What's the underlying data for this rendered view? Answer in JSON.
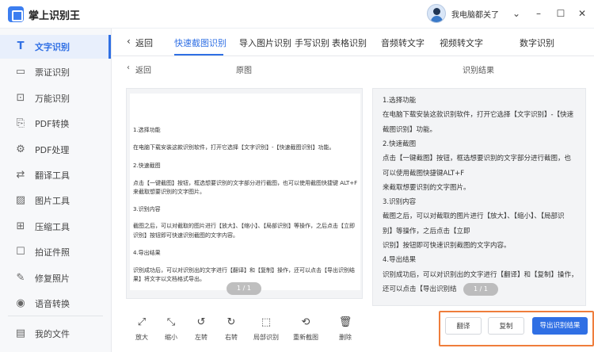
{
  "app": {
    "title": "掌上识别王",
    "user_name": "我电脑都关了"
  },
  "window_controls": {
    "chevron": "⌄",
    "minimize": "–",
    "maximize": "☐",
    "close": "✕"
  },
  "sidebar": {
    "items": [
      {
        "label": "文字识别",
        "icon": "text-recognition-icon",
        "active": true
      },
      {
        "label": "票证识别",
        "icon": "ticket-icon"
      },
      {
        "label": "万能识别",
        "icon": "scan-icon"
      },
      {
        "label": "PDF转换",
        "icon": "pdf-icon"
      },
      {
        "label": "PDF处理",
        "icon": "pdf-process-icon"
      },
      {
        "label": "翻译工具",
        "icon": "translate-icon"
      },
      {
        "label": "图片工具",
        "icon": "image-icon"
      },
      {
        "label": "压缩工具",
        "icon": "compress-icon"
      },
      {
        "label": "拍证件照",
        "icon": "id-photo-icon"
      },
      {
        "label": "修复照片",
        "icon": "repair-icon"
      },
      {
        "label": "语音转换",
        "icon": "voice-icon"
      }
    ],
    "files_label": "我的文件"
  },
  "tabs": {
    "back_label": "返回",
    "items": [
      "快速截图识别",
      "导入图片识别",
      "手写识别",
      "表格识别",
      "音频转文字",
      "视频转文字",
      "数字识别"
    ],
    "active_index": 0
  },
  "subheader": {
    "back_label": "返回",
    "original_label": "原图",
    "result_label": "识别结果"
  },
  "original_doc": {
    "lines": [
      "1.选择功能",
      "在电脑下载安装这款识别软件，打开它选择【文字识别】-【快速截图识别】功能。",
      "2.快速截图",
      "点击【一键截图】按钮，框选想要识别的文字部分进行截图，也可以使用截图快捷键 ALT+F",
      "来截取想要识别的文字图片。",
      "3.识别内容",
      "截图之后，可以对截取的图片进行【放大】、【缩小】、【局部识别】等操作，之后点击【立即",
      "识别】按钮即可快速识别截图的文字内容。",
      "4.导出结果",
      "识别成功后，可以对识别出的文字进行【翻译】和【复制】操作，还可以点击【导出识别结",
      "果】将文字以文档格式导出。"
    ],
    "page_indicator": "1 / 1"
  },
  "result_doc": {
    "lines": [
      "1.选择功能",
      "在电脑下载安装这款识别软件，打开它选择【文字识别】-【快速",
      "截图识别】功能。",
      "2.快速截图",
      "点击【一键截图】按钮，框选想要识别的文字部分进行截图，也",
      "可以使用截图快捷键ALT+F",
      "来截取想要识别的文字图片。",
      "3.识别内容",
      "截图之后，可以对截取的图片进行【放大】、【缩小】、【局部识",
      "别】等操作，之后点击【立即",
      "识别】按钮即可快速识别截图的文字内容。",
      "4.导出结果",
      "识别成功后，可以对识别出的文字进行【翻译】和【复制】操作，",
      "还可以点击【导出识别结"
    ],
    "page_indicator": "1 / 1"
  },
  "toolbar": {
    "tools": [
      {
        "label": "放大",
        "icon": "zoom-in-icon",
        "glyph": "⤢"
      },
      {
        "label": "缩小",
        "icon": "zoom-out-icon",
        "glyph": "⤡"
      },
      {
        "label": "左转",
        "icon": "rotate-left-icon",
        "glyph": "↺"
      },
      {
        "label": "右转",
        "icon": "rotate-right-icon",
        "glyph": "↻"
      },
      {
        "label": "局部识别",
        "icon": "partial-recognize-icon",
        "glyph": "⬚"
      },
      {
        "label": "重新截图",
        "icon": "recapture-icon",
        "glyph": "⟲"
      },
      {
        "label": "删除",
        "icon": "delete-icon",
        "glyph": "🗑"
      }
    ]
  },
  "actions": {
    "translate_label": "翻译",
    "copy_label": "复制",
    "export_label": "导出识别结果"
  },
  "colors": {
    "accent": "#2f6fe4",
    "highlight_border": "#ef7d3c",
    "sidebar_bg": "#f7f8fa"
  }
}
